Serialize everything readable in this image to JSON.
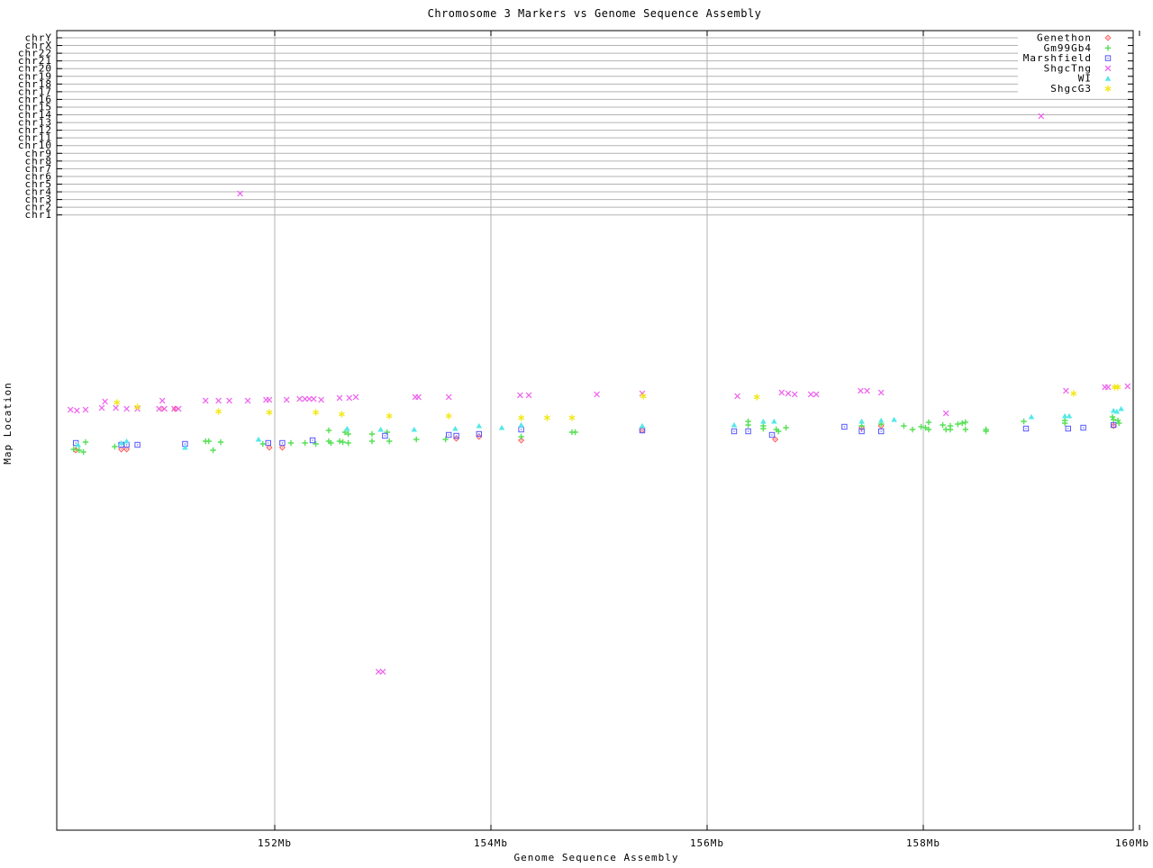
{
  "title": "Chromosome 3 Markers vs Genome Sequence Assembly",
  "axes": {
    "x": {
      "label": "Genome Sequence Assembly",
      "units": "Mb",
      "range_mb": [
        149.98,
        159.94
      ],
      "ticks": [
        {
          "label": "152Mb",
          "mb": 152,
          "grid": true
        },
        {
          "label": "154Mb",
          "mb": 154,
          "grid": true
        },
        {
          "label": "156Mb",
          "mb": 156,
          "grid": true
        },
        {
          "label": "158Mb",
          "mb": 158,
          "grid": true
        },
        {
          "label": "160Mb",
          "mb": 160,
          "grid": false
        }
      ]
    },
    "y": {
      "label": "Map Location",
      "numeric_scale_shown": false,
      "categories": [
        "chrY",
        "chrX",
        "chr22",
        "chr21",
        "chr20",
        "chr19",
        "chr18",
        "chr17",
        "chr16",
        "chr15",
        "chr14",
        "chr13",
        "chr12",
        "chr11",
        "chr10",
        "chr9",
        "chr8",
        "chr7",
        "chr6",
        "chr5",
        "chr4",
        "chr3",
        "chr2",
        "chr1"
      ]
    }
  },
  "colors": {
    "grid": "#b3b3b3",
    "border": "#000000",
    "background": "#ffffff"
  },
  "chart_data": {
    "type": "scatter",
    "title": "Chromosome 3 Markers vs Genome Sequence Assembly",
    "xlabel": "Genome Sequence Assembly",
    "ylabel": "Map Location",
    "x_units": "Mb",
    "y_units": "plot px (map-location axis has no numeric labels; chromosome offset ticks chrY..chr1 at top)",
    "legend_position": "top-right",
    "grid": true,
    "series": [
      {
        "name": "Genethon",
        "marker": "diamond",
        "color": "#ff5555",
        "points": [
          [
            150.16,
            500
          ],
          [
            150.58,
            499
          ],
          [
            150.63,
            499
          ],
          [
            150.95,
            454
          ],
          [
            151.08,
            454
          ],
          [
            151.95,
            497
          ],
          [
            152.07,
            497
          ],
          [
            153.68,
            487
          ],
          [
            153.89,
            485
          ],
          [
            154.28,
            489
          ],
          [
            155.4,
            478
          ],
          [
            156.63,
            488
          ],
          [
            157.43,
            475
          ],
          [
            157.61,
            473
          ],
          [
            159.76,
            473
          ]
        ]
      },
      {
        "name": "Gm99Gb4",
        "marker": "plus",
        "color": "#55e055",
        "points": [
          [
            150.14,
            499
          ],
          [
            150.19,
            500
          ],
          [
            150.23,
            502
          ],
          [
            150.25,
            491
          ],
          [
            150.52,
            496
          ],
          [
            151.36,
            490
          ],
          [
            151.39,
            490
          ],
          [
            151.43,
            500
          ],
          [
            151.5,
            491
          ],
          [
            151.89,
            493
          ],
          [
            152.15,
            492
          ],
          [
            152.28,
            492
          ],
          [
            152.38,
            493
          ],
          [
            152.5,
            478
          ],
          [
            152.5,
            490
          ],
          [
            152.52,
            492
          ],
          [
            152.6,
            490
          ],
          [
            152.63,
            491
          ],
          [
            152.65,
            480
          ],
          [
            152.68,
            482
          ],
          [
            152.68,
            492
          ],
          [
            152.9,
            482
          ],
          [
            152.9,
            490
          ],
          [
            153.04,
            480
          ],
          [
            153.06,
            490
          ],
          [
            153.31,
            488
          ],
          [
            153.58,
            488
          ],
          [
            154.28,
            485
          ],
          [
            154.75,
            480
          ],
          [
            154.78,
            480
          ],
          [
            156.38,
            468
          ],
          [
            156.38,
            472
          ],
          [
            156.52,
            473
          ],
          [
            156.52,
            476
          ],
          [
            156.64,
            477
          ],
          [
            156.66,
            479
          ],
          [
            156.73,
            475
          ],
          [
            157.43,
            473
          ],
          [
            157.61,
            471
          ],
          [
            157.82,
            473
          ],
          [
            157.9,
            477
          ],
          [
            157.98,
            474
          ],
          [
            158.02,
            475
          ],
          [
            158.05,
            469
          ],
          [
            158.05,
            477
          ],
          [
            158.18,
            472
          ],
          [
            158.21,
            477
          ],
          [
            158.25,
            473
          ],
          [
            158.25,
            477
          ],
          [
            158.32,
            471
          ],
          [
            158.36,
            470
          ],
          [
            158.39,
            469
          ],
          [
            158.39,
            477
          ],
          [
            158.58,
            477
          ],
          [
            158.58,
            479
          ],
          [
            158.93,
            468
          ],
          [
            159.31,
            467
          ],
          [
            159.31,
            470
          ],
          [
            159.75,
            463
          ],
          [
            159.76,
            466
          ],
          [
            159.8,
            467
          ],
          [
            159.81,
            470
          ]
        ]
      },
      {
        "name": "Marshfield",
        "marker": "square",
        "color": "#5555ff",
        "points": [
          [
            150.16,
            492
          ],
          [
            150.58,
            494
          ],
          [
            150.63,
            494
          ],
          [
            150.73,
            494
          ],
          [
            151.17,
            493
          ],
          [
            151.94,
            492
          ],
          [
            152.07,
            492
          ],
          [
            152.35,
            489
          ],
          [
            153.02,
            484
          ],
          [
            153.61,
            483
          ],
          [
            153.68,
            484
          ],
          [
            153.89,
            482
          ],
          [
            154.28,
            477
          ],
          [
            155.4,
            478
          ],
          [
            156.25,
            479
          ],
          [
            156.38,
            479
          ],
          [
            156.6,
            483
          ],
          [
            157.27,
            474
          ],
          [
            157.43,
            479
          ],
          [
            157.61,
            479
          ],
          [
            158.95,
            476
          ],
          [
            159.34,
            476
          ],
          [
            159.48,
            475
          ],
          [
            159.76,
            472
          ]
        ]
      },
      {
        "name": "ShgcTng",
        "marker": "x",
        "color": "#ee66ee",
        "points": [
          [
            150.11,
            455
          ],
          [
            150.17,
            456
          ],
          [
            150.25,
            455
          ],
          [
            150.4,
            453
          ],
          [
            150.43,
            446
          ],
          [
            150.53,
            453
          ],
          [
            150.63,
            454
          ],
          [
            150.73,
            454
          ],
          [
            150.93,
            454
          ],
          [
            150.96,
            445
          ],
          [
            150.98,
            454
          ],
          [
            151.07,
            454
          ],
          [
            151.11,
            454
          ],
          [
            151.36,
            445
          ],
          [
            151.48,
            445
          ],
          [
            151.58,
            445
          ],
          [
            151.68,
            215
          ],
          [
            151.75,
            445
          ],
          [
            151.92,
            444
          ],
          [
            151.95,
            444
          ],
          [
            152.11,
            444
          ],
          [
            152.23,
            443
          ],
          [
            152.28,
            443
          ],
          [
            152.32,
            443
          ],
          [
            152.36,
            443
          ],
          [
            152.43,
            444
          ],
          [
            152.6,
            442
          ],
          [
            152.69,
            442
          ],
          [
            152.75,
            441
          ],
          [
            152.96,
            746
          ],
          [
            153.0,
            746
          ],
          [
            153.3,
            441
          ],
          [
            153.33,
            441
          ],
          [
            153.61,
            441
          ],
          [
            154.27,
            439
          ],
          [
            154.35,
            439
          ],
          [
            154.98,
            438
          ],
          [
            155.4,
            437
          ],
          [
            156.28,
            440
          ],
          [
            156.69,
            436
          ],
          [
            156.75,
            437
          ],
          [
            156.81,
            438
          ],
          [
            156.96,
            438
          ],
          [
            157.01,
            438
          ],
          [
            157.42,
            434
          ],
          [
            157.48,
            434
          ],
          [
            157.61,
            436
          ],
          [
            158.21,
            459
          ],
          [
            159.09,
            129
          ],
          [
            159.32,
            434
          ],
          [
            159.68,
            430
          ],
          [
            159.71,
            430
          ],
          [
            159.89,
            429
          ]
        ]
      },
      {
        "name": "WI",
        "marker": "triangle",
        "color": "#55e8e8",
        "points": [
          [
            150.18,
            494
          ],
          [
            150.58,
            492
          ],
          [
            150.63,
            490
          ],
          [
            151.17,
            497
          ],
          [
            151.85,
            488
          ],
          [
            152.67,
            476
          ],
          [
            152.98,
            477
          ],
          [
            153.29,
            477
          ],
          [
            153.67,
            476
          ],
          [
            153.89,
            473
          ],
          [
            154.1,
            475
          ],
          [
            154.28,
            472
          ],
          [
            155.4,
            473
          ],
          [
            156.25,
            472
          ],
          [
            156.52,
            468
          ],
          [
            156.62,
            468
          ],
          [
            157.43,
            468
          ],
          [
            157.61,
            467
          ],
          [
            157.73,
            466
          ],
          [
            159.0,
            463
          ],
          [
            159.31,
            462
          ],
          [
            159.35,
            462
          ],
          [
            159.76,
            456
          ],
          [
            159.79,
            457
          ],
          [
            159.83,
            454
          ]
        ]
      },
      {
        "name": "ShgcG3",
        "marker": "star",
        "color": "#f2e816",
        "points": [
          [
            150.54,
            447
          ],
          [
            150.73,
            452
          ],
          [
            151.48,
            457
          ],
          [
            151.95,
            458
          ],
          [
            152.38,
            458
          ],
          [
            152.62,
            460
          ],
          [
            153.06,
            462
          ],
          [
            153.61,
            462
          ],
          [
            154.28,
            464
          ],
          [
            154.52,
            464
          ],
          [
            154.75,
            464
          ],
          [
            155.41,
            440
          ],
          [
            156.46,
            441
          ],
          [
            159.39,
            437
          ],
          [
            159.77,
            430
          ],
          [
            159.8,
            430
          ]
        ]
      }
    ]
  }
}
